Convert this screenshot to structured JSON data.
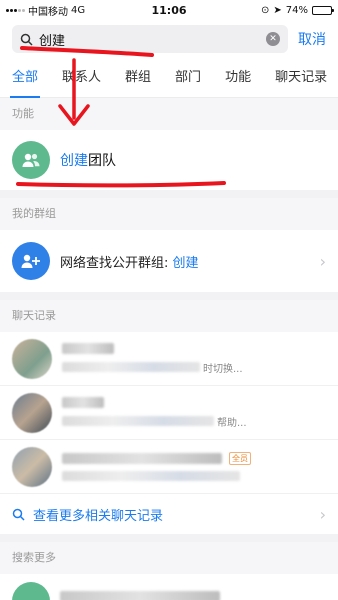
{
  "status_bar": {
    "carrier": "中国移动",
    "network": "4G",
    "time": "11:06",
    "battery": "74%",
    "battery_level": 0.74
  },
  "search": {
    "query": "创建",
    "cancel_label": "取消"
  },
  "tabs": [
    "全部",
    "联系人",
    "群组",
    "部门",
    "功能",
    "聊天记录"
  ],
  "sections": {
    "functions": "功能",
    "my_groups": "我的群组",
    "chat_history": "聊天记录",
    "search_more": "搜索更多"
  },
  "feature_item": {
    "label_highlight": "创建",
    "label_rest": "团队"
  },
  "group_item": {
    "label_prefix": "网络查找公开群组: ",
    "label_highlight": "创建"
  },
  "chat_items": [
    {
      "snippet": "时切换..."
    },
    {
      "snippet": "帮助..."
    },
    {
      "tag": "全员"
    }
  ],
  "more_chats_label": "查看更多相关聊天记录",
  "colors": {
    "accent": "#1b7cf0",
    "annotation": "#e8141e",
    "feature_icon_bg": "#5fb98f",
    "group_icon_bg": "#2f80e7"
  }
}
